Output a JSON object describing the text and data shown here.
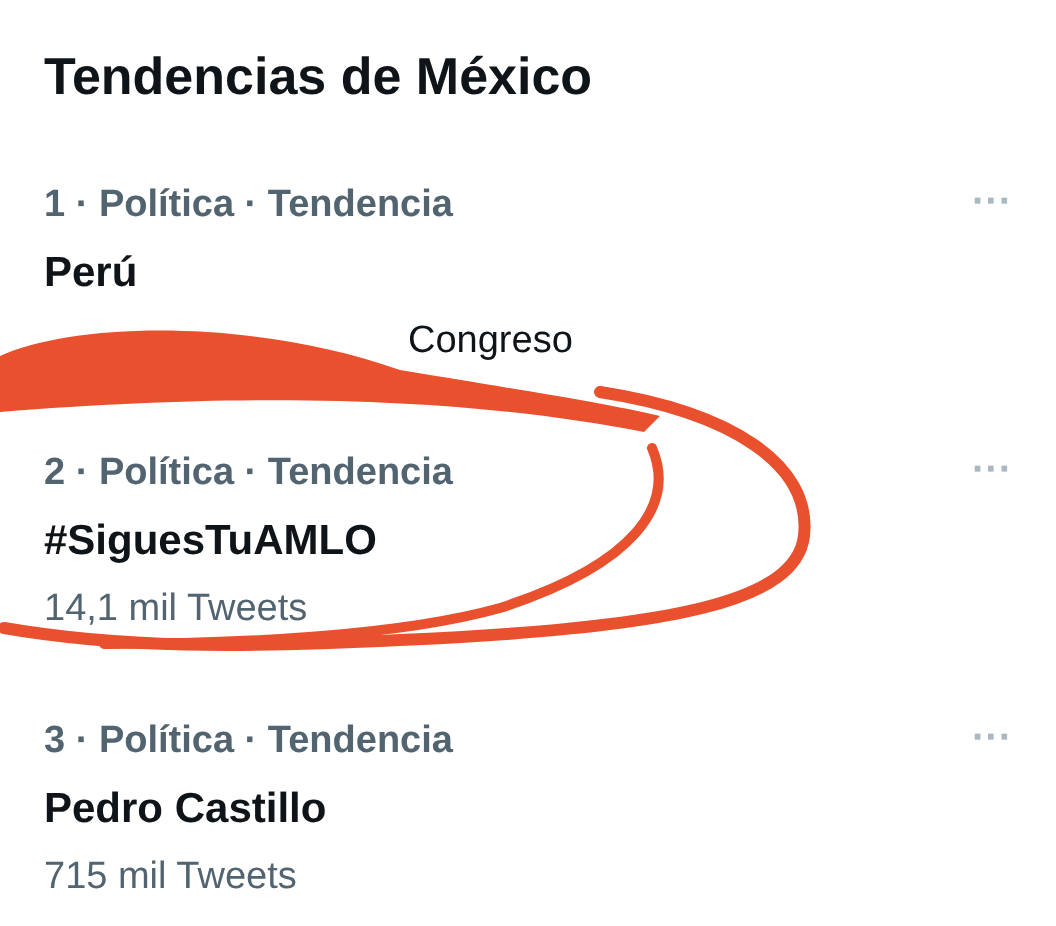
{
  "title": "Tendencias de México",
  "trends": [
    {
      "meta": "1 · Política · Tendencia",
      "name": "Perú",
      "detail": "Congreso",
      "more": "···"
    },
    {
      "meta": "2 · Política · Tendencia",
      "name": "#SiguesTuAMLO",
      "detail": "14,1 mil Tweets",
      "more": "···"
    },
    {
      "meta": "3 · Política · Tendencia",
      "name": "Pedro Castillo",
      "detail": "715 mil Tweets",
      "more": "···"
    }
  ]
}
